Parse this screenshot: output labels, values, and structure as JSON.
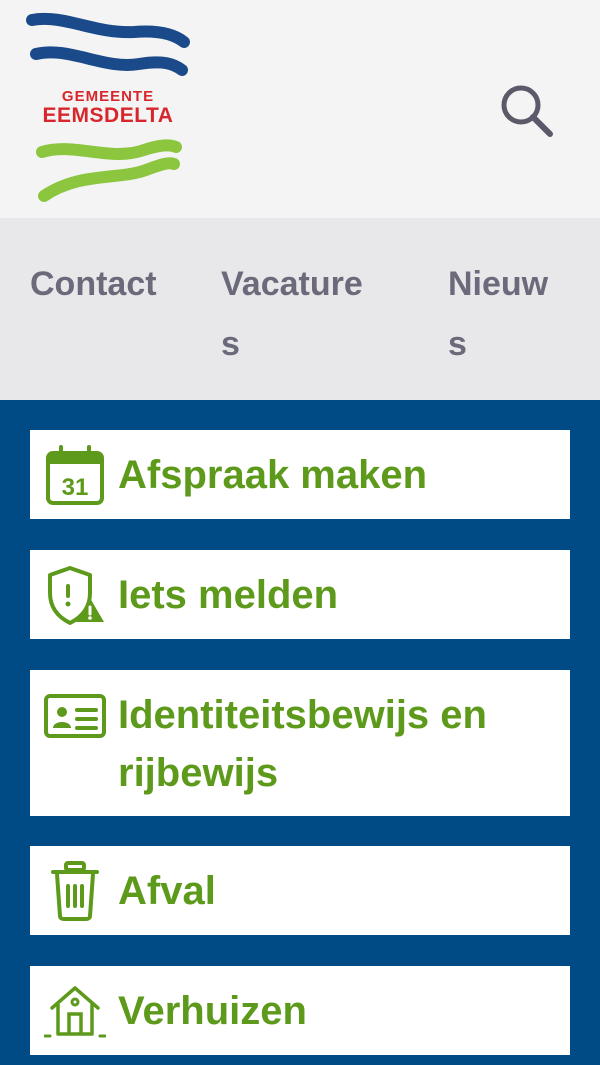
{
  "brand": {
    "line1": "GEMEENTE",
    "line2": "EEMSDELTA",
    "blue": "#1b4a8a",
    "green": "#8cc63f",
    "red": "#d8262d"
  },
  "header": {
    "search_icon": "search-icon"
  },
  "nav": {
    "items": [
      "Contact",
      "Vacatures",
      "Nieuws"
    ]
  },
  "tiles": [
    {
      "label": "Afspraak maken",
      "icon": "calendar-icon"
    },
    {
      "label": "Iets melden",
      "icon": "shield-warning-icon"
    },
    {
      "label": "Identiteitsbewijs en rijbewijs",
      "icon": "id-card-icon"
    },
    {
      "label": "Afval",
      "icon": "trash-icon"
    },
    {
      "label": "Verhuizen",
      "icon": "house-move-icon"
    }
  ],
  "colors": {
    "primary_blue": "#004a86",
    "tile_green": "#5d9a1b",
    "nav_text": "#6b6a7b"
  }
}
